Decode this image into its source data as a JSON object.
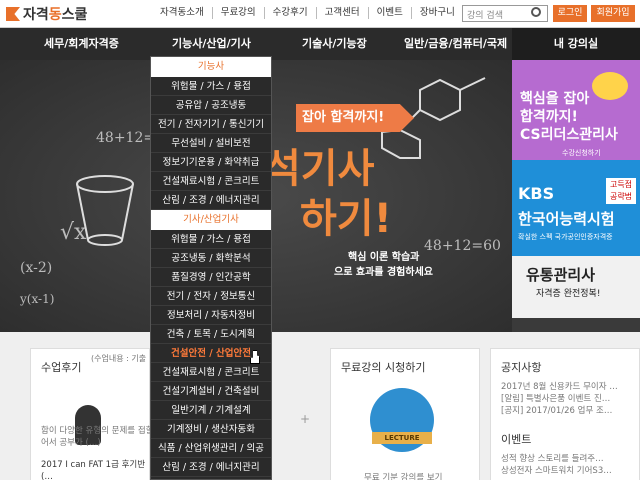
{
  "topbar": {
    "logo_text_a": "자격",
    "logo_text_b": "동",
    "logo_text_c": "스쿨",
    "nav": [
      "자격동소개",
      "무료강의",
      "수강후기",
      "고객센터",
      "이벤트",
      "장바구니"
    ],
    "search_placeholder": "강의 검색",
    "login": "로그인",
    "join": "회원가입"
  },
  "mainnav": {
    "items": [
      "세무/회계자격증",
      "기능사/산업/기사",
      "기술사/기능장",
      "일반/금융/컴퓨터/국제"
    ],
    "mine": "내 강의실"
  },
  "hero": {
    "ribbon": "잡아 합격까지!",
    "title_line1": "석기사",
    "title_line2": "하기!",
    "sub_line1": "핵심 이론 학습과",
    "sub_line2": "으로 효과를 경험하세요",
    "chalk": [
      "48+12=60",
      "(x-2)",
      "√x",
      "48+12=60",
      "y(x-1)"
    ]
  },
  "side_ads": {
    "ad1_title": "핵심을 잡아\n합격까지!\nCS리더스관리사",
    "ad1_sub": "수강신청하기",
    "ad2_title1": "KBS",
    "ad2_tag": "고득점\n공략법",
    "ad2_title2": "한국어능력시험",
    "ad2_sub": "확실한 스펙 국가공인인증자격증",
    "ad3_title": "유통관리사",
    "ad3_sub": "자격증 완전정복!"
  },
  "dropdown": {
    "head1": "기능사",
    "group1": [
      "위험물 / 가스 / 용접",
      "공유압 / 공조냉동",
      "전기 / 전자기기 / 통신기기",
      "무선설비 / 설비보전",
      "정보기기운용 / 화약취급",
      "건설재료시험 / 콘크리트",
      "산림 / 조경 / 에너지관리"
    ],
    "head2": "기사/산업기사",
    "group2": [
      "위험물 / 가스 / 용접",
      "공조냉동 / 화학분석",
      "품질경영 / 인간공학",
      "전기 / 전자 / 정보통신",
      "정보처리 / 자동차정비",
      "건축 / 토목 / 도시계획",
      "건설안전 / 산업안전",
      "건설재료시험 / 콘크리트",
      "건설기계설비 / 건축설비",
      "일반기계 / 기계설계",
      "기계정비 / 생산자동화",
      "식품 / 산업위생관리 / 의공",
      "산림 / 조경 / 에너지관리",
      "소방설비 / 화약류 / 폐기물"
    ],
    "active_label": "건설안전 / 산업안전"
  },
  "bottom": {
    "review_title": "수업후기",
    "review_lines": [
      "(수업내용 : 기출",
      "게 18회분을 풀",
      "해 강의를 통해",
      "다. 기출문제",
      "함이 다양한 유형의 문제를 접할 수 있",
      "어서 공부가 (…)"
    ],
    "review_item": "2017 I can FAT 1급 후기반 (…",
    "free_title": "무료강의 시청하기",
    "lecture_badge": "LECTURE",
    "free_caption": "무료 기분 강의를 보기",
    "notice_title": "공지사항",
    "notice_lines": [
      "2017년 8월 신용카드 무이자 …",
      "[알림] 특별사은품 이벤트 진…",
      "[공지] 2017/01/26 업무 조…"
    ],
    "event_title": "이벤트",
    "event_lines": [
      "성적 향상 스토리를 들려주…",
      "상성전자 스마트워치 기어S3…"
    ],
    "plus": "+"
  }
}
